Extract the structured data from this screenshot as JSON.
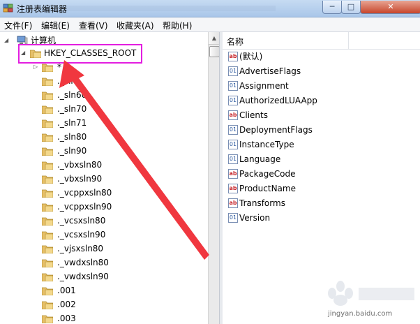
{
  "window": {
    "title": "注册表编辑器",
    "controls": {
      "minimize": "─",
      "maximize": "□",
      "close": "✕"
    }
  },
  "menu": [
    "文件(F)",
    "编辑(E)",
    "查看(V)",
    "收藏夹(A)",
    "帮助(H)"
  ],
  "tree": {
    "computer": "计算机",
    "root_key": "HKEY_CLASSES_ROOT",
    "keys": [
      "*",
      "._sln",
      "._sln60",
      "._sln70",
      "._sln71",
      "._sln80",
      "._sln90",
      "._vbxsln80",
      "._vbxsln90",
      "._vcppxsln80",
      "._vcppxsln90",
      "._vcsxsln80",
      "._vcsxsln90",
      "._vjsxsln80",
      "._vwdxsln80",
      "._vwdxsln90",
      ".001",
      ".002",
      ".003"
    ]
  },
  "values_pane": {
    "column_name": "名称",
    "values": [
      {
        "name": "(默认)",
        "type": "sz"
      },
      {
        "name": "AdvertiseFlags",
        "type": "bin"
      },
      {
        "name": "Assignment",
        "type": "bin"
      },
      {
        "name": "AuthorizedLUAApp",
        "type": "bin"
      },
      {
        "name": "Clients",
        "type": "sz"
      },
      {
        "name": "DeploymentFlags",
        "type": "bin"
      },
      {
        "name": "InstanceType",
        "type": "bin"
      },
      {
        "name": "Language",
        "type": "bin"
      },
      {
        "name": "PackageCode",
        "type": "sz"
      },
      {
        "name": "ProductName",
        "type": "sz"
      },
      {
        "name": "Transforms",
        "type": "sz"
      },
      {
        "name": "Version",
        "type": "bin"
      }
    ]
  },
  "annotation": {
    "box_color": "#e31ee0",
    "arrow_color": "#f0373f"
  },
  "watermark": {
    "text": "jingyan.baidu.com"
  }
}
